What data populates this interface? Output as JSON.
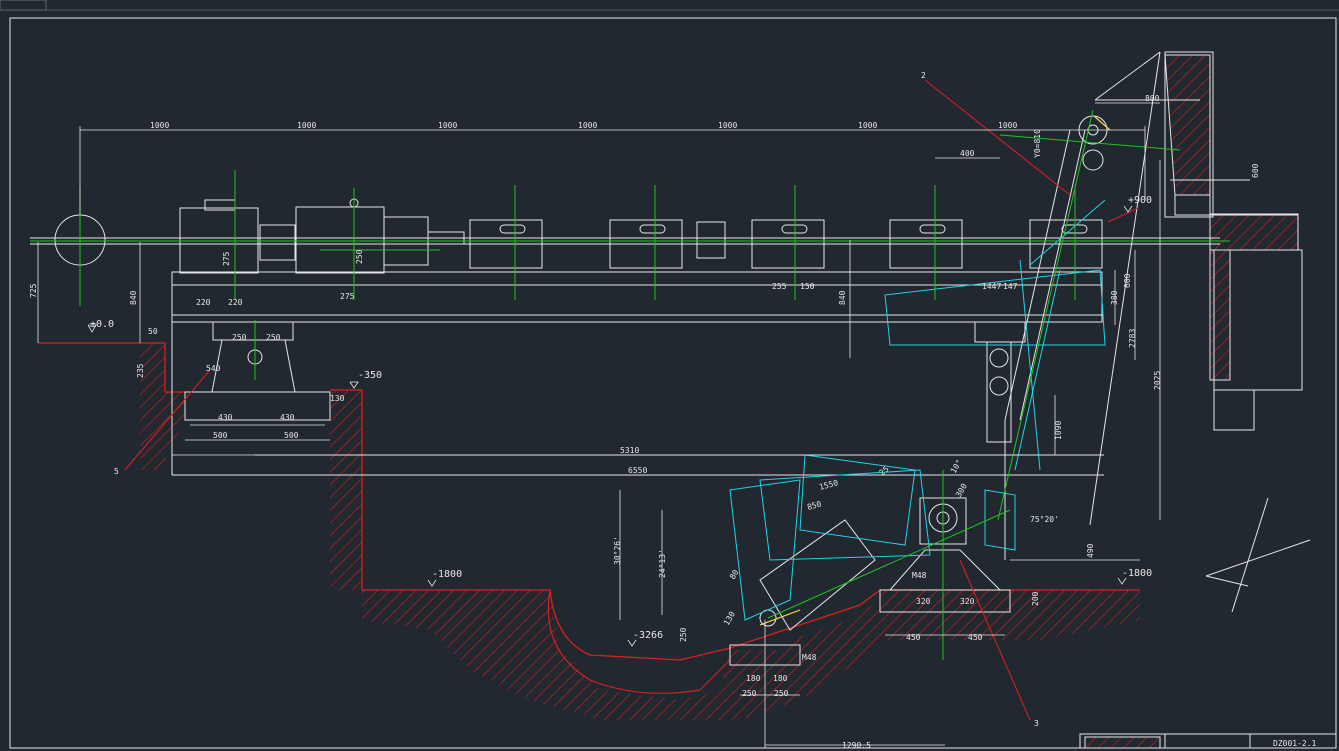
{
  "colors": {
    "background": "#212830",
    "outline": "#e6e6e6",
    "centerline": "#22c322",
    "hatch": "#d62020",
    "alt_position": "#22d3e6",
    "highlight": "#ffd84a"
  },
  "title_block": {
    "drawing_number": "DZ001-2.1"
  },
  "dimensions": {
    "top_spacing": [
      "1000",
      "1000",
      "1000",
      "1000",
      "1000",
      "1000",
      "1000"
    ],
    "top_400": "400",
    "top_800": "800",
    "y0": "Y0=810",
    "h600_right": "600",
    "left_725": "725",
    "left_840": "840",
    "d275": "275",
    "d250": "250",
    "d220a": "220",
    "d220b": "220",
    "d275b": "275",
    "d255": "255",
    "d150": "150",
    "d840b": "840",
    "d380": "380",
    "d600": "600",
    "d1447": "1447",
    "d147": "147",
    "d2783": "2783",
    "d2025": "2025",
    "d1090": "1090",
    "d50": "50",
    "d235": "235",
    "d250b": "250",
    "d250c": "250",
    "d540": "540",
    "d430a": "430",
    "d430b": "430",
    "d130": "130",
    "d500a": "500",
    "d500b": "500",
    "d5310": "5310",
    "d6550": "6550",
    "d1550": "1550",
    "d850": "850",
    "ang30": "30°26'",
    "ang24": "24°13'",
    "ang10": "10°",
    "d80": "80",
    "d130b": "130",
    "d300": "300",
    "d250d": "250",
    "d180a": "180",
    "d180b": "180",
    "d250e": "250",
    "d250f": "250",
    "d1290": "1290.5",
    "d320a": "320",
    "d320b": "320",
    "d450a": "450",
    "d450b": "450",
    "d200": "200",
    "d490": "490",
    "d25": "25",
    "ang75": "75°20'",
    "m48a": "M48",
    "m48b": "M48"
  },
  "levels": {
    "zero": "±0.0",
    "minus350": "-350",
    "plus900": "+900",
    "minus1800a": "-1800",
    "minus1800b": "-1800",
    "minus3266": "-3266"
  },
  "callouts": [
    "2",
    "5",
    "3"
  ]
}
